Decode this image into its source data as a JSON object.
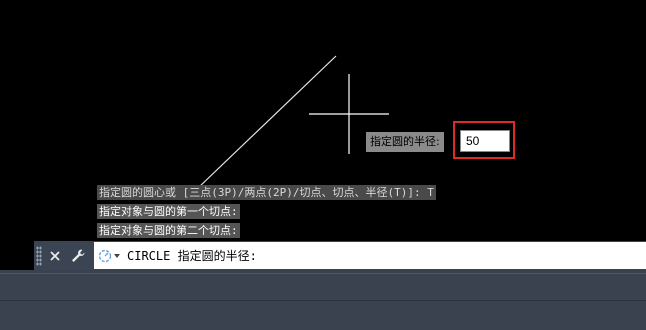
{
  "canvas": {
    "dynamic_prompt_label": "指定圆的半径:",
    "dynamic_input_value": "50",
    "highlight_color": "#e02a2a"
  },
  "history": {
    "lines": [
      "指定圆的圆心或 [三点(3P)/两点(2P)/切点、切点、半径(T)]: T",
      "指定对象与圆的第一个切点:",
      "指定对象与圆的第二个切点:"
    ]
  },
  "command_line": {
    "close_icon": "close-icon",
    "customize_icon": "wrench-icon",
    "recent_icon": "recent-commands-icon",
    "prompt_text": "CIRCLE 指定圆的半径:"
  },
  "colors": {
    "canvas_bg": "#000000",
    "command_bar_bg": "#3b4453",
    "drawing_line": "#ffffff"
  }
}
